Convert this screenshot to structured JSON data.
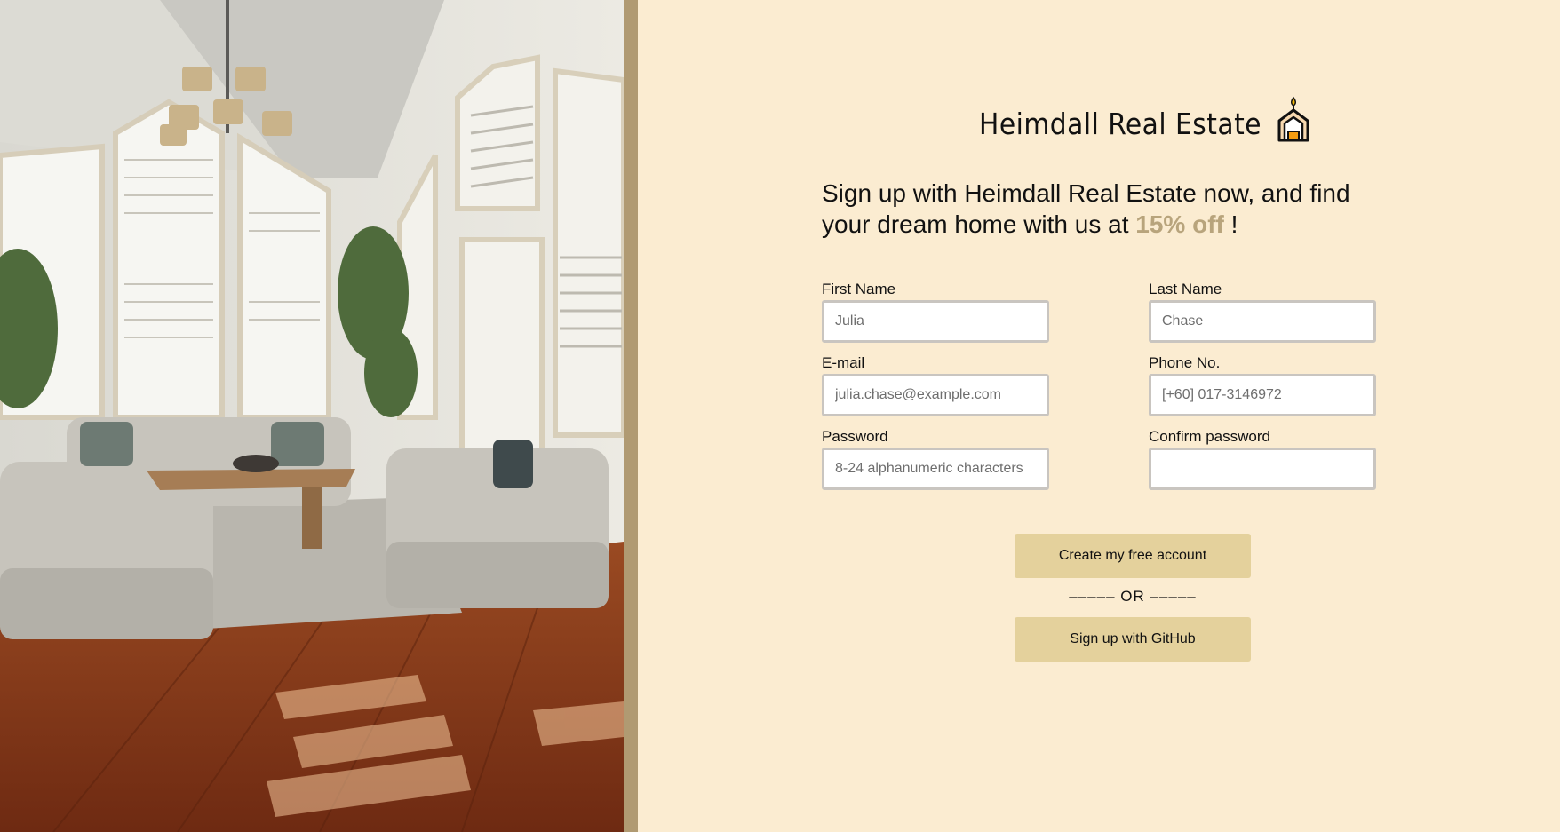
{
  "brand": {
    "name": "Heimdall Real Estate",
    "icon": "house-candle-icon"
  },
  "headline": {
    "line1": "Sign up with Heimdall Real Estate now, and find",
    "line2_prefix": "your dream home with us at ",
    "discount": "15% off",
    "line2_suffix": " !"
  },
  "form": {
    "first_name": {
      "label": "First Name",
      "placeholder": "Julia"
    },
    "last_name": {
      "label": "Last Name",
      "placeholder": "Chase"
    },
    "email": {
      "label": "E-mail",
      "placeholder": "julia.chase@example.com"
    },
    "phone": {
      "label": "Phone No.",
      "placeholder": "[+60] 017-3146972"
    },
    "password": {
      "label": "Password",
      "placeholder": "8-24 alphanumeric characters"
    },
    "confirm_password": {
      "label": "Confirm password",
      "placeholder": ""
    }
  },
  "actions": {
    "create_account": "Create my free account",
    "separator": "–––––   OR   –––––",
    "github": "Sign up with GitHub"
  },
  "colors": {
    "background": "#fbecd1",
    "accent": "#b8a47c",
    "button": "#e4d19c",
    "divider": "#b09a72"
  }
}
